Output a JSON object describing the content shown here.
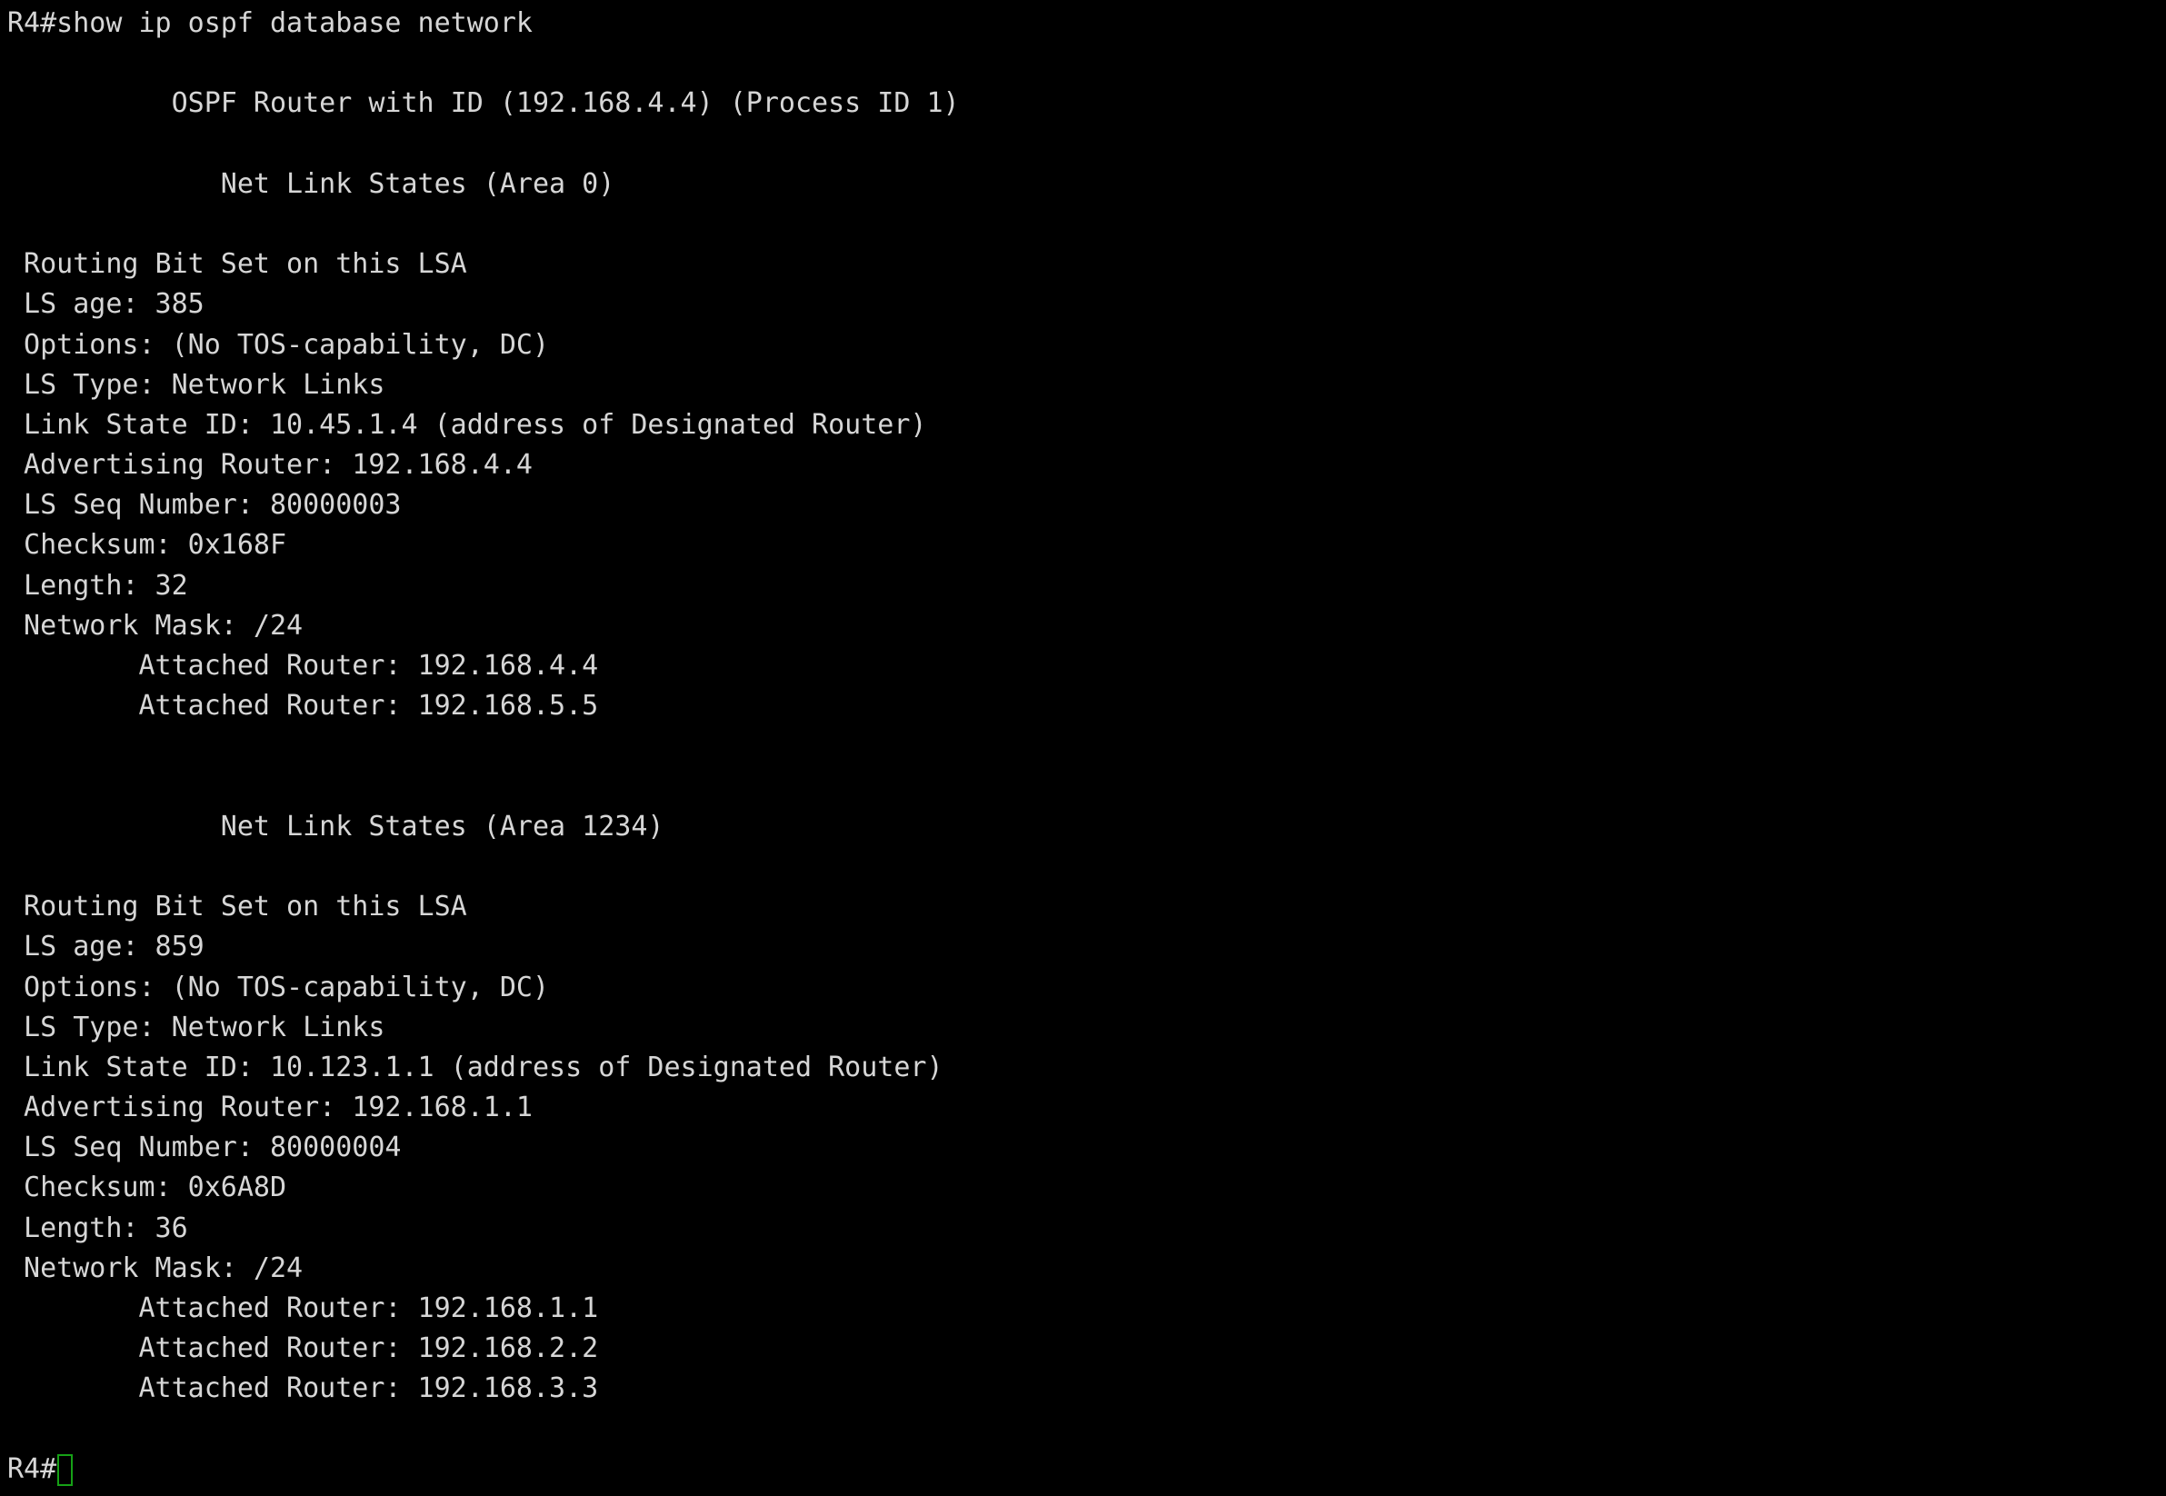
{
  "terminal": {
    "colors": {
      "background": "#000000",
      "foreground": "#d6d6d6",
      "cursor_outline": "#16a116"
    },
    "command_line": "R4#show ip ospf database network",
    "router_header": "          OSPF Router with ID (192.168.4.4) (Process ID 1)",
    "prompt": "R4#",
    "sections": [
      {
        "header": "             Net Link States (Area 0)",
        "lines": [
          " Routing Bit Set on this LSA",
          " LS age: 385",
          " Options: (No TOS-capability, DC)",
          " LS Type: Network Links",
          " Link State ID: 10.45.1.4 (address of Designated Router)",
          " Advertising Router: 192.168.4.4",
          " LS Seq Number: 80000003",
          " Checksum: 0x168F",
          " Length: 32",
          " Network Mask: /24",
          "        Attached Router: 192.168.4.4",
          "        Attached Router: 192.168.5.5"
        ]
      },
      {
        "header": "             Net Link States (Area 1234)",
        "lines": [
          " Routing Bit Set on this LSA",
          " LS age: 859",
          " Options: (No TOS-capability, DC)",
          " LS Type: Network Links",
          " Link State ID: 10.123.1.1 (address of Designated Router)",
          " Advertising Router: 192.168.1.1",
          " LS Seq Number: 80000004",
          " Checksum: 0x6A8D",
          " Length: 36",
          " Network Mask: /24",
          "        Attached Router: 192.168.1.1",
          "        Attached Router: 192.168.2.2",
          "        Attached Router: 192.168.3.3"
        ]
      }
    ]
  }
}
